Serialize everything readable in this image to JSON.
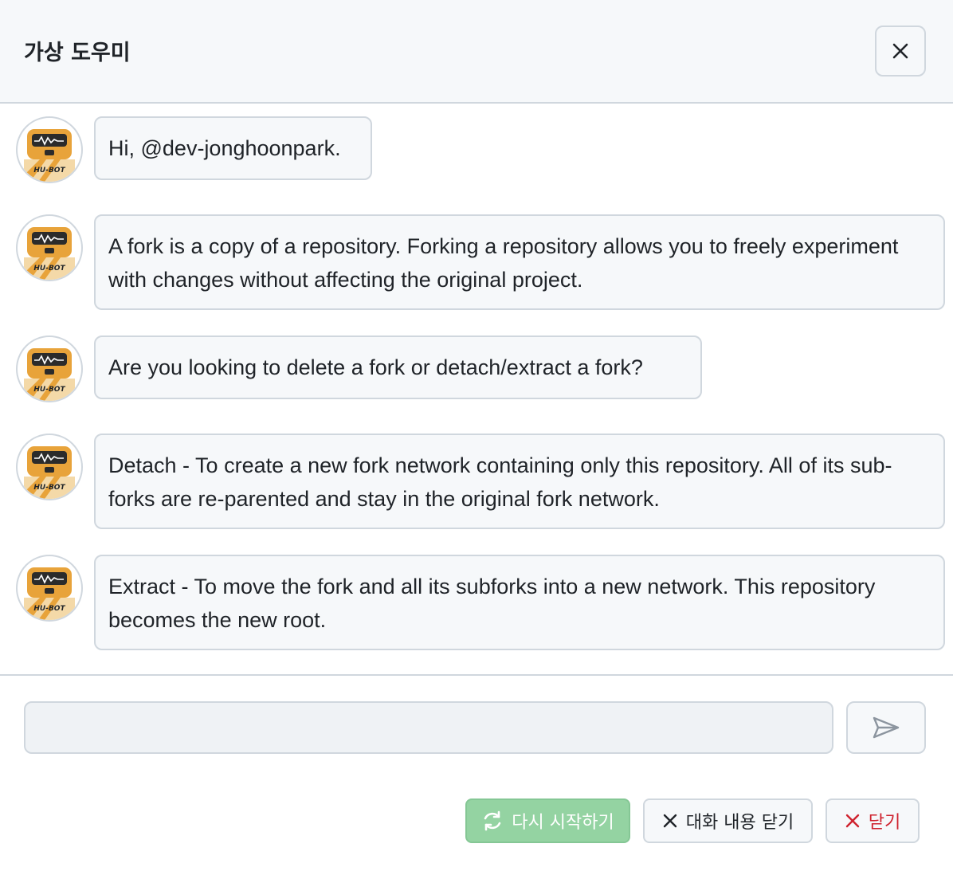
{
  "header": {
    "title": "가상 도우미"
  },
  "bot": {
    "badge_text": "HU-BOT"
  },
  "messages": [
    {
      "text": "Hi, @dev-jonghoonpark."
    },
    {
      "text": "A fork is a copy of a repository. Forking a repository allows you to freely experiment with changes without affecting the original project."
    },
    {
      "text": "Are you looking to delete a fork or detach/extract a fork?"
    },
    {
      "text": "Detach - To create a new fork network containing only this repository. All of its sub-forks are re-parented and stay in the original fork network."
    },
    {
      "text": "Extract - To move the fork and all its subforks into a new network. This repository becomes the new root."
    }
  ],
  "composer": {
    "input_value": "",
    "send_icon": "send-icon"
  },
  "actions": {
    "restart_label": "다시 시작하기",
    "close_chat_label": "대화 내용 닫기",
    "close_label": "닫기"
  },
  "colors": {
    "restart_bg": "#94d3a2",
    "danger": "#cf222e",
    "bot_orange": "#e8a33a"
  }
}
